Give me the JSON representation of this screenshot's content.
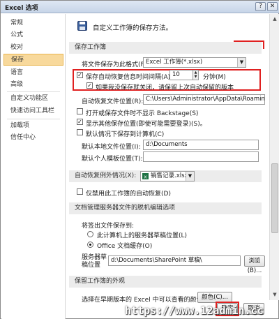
{
  "window": {
    "title": "Excel 选项",
    "help_btn": "?",
    "close_btn": "✕"
  },
  "sidebar": {
    "items": [
      {
        "label": "常规"
      },
      {
        "label": "公式"
      },
      {
        "label": "校对"
      },
      {
        "label": "保存",
        "selected": true
      },
      {
        "label": "语言"
      },
      {
        "label": "高级"
      },
      {
        "label": "自定义功能区"
      },
      {
        "label": "快速访问工具栏"
      },
      {
        "label": "加载项"
      },
      {
        "label": "信任中心"
      }
    ]
  },
  "main": {
    "heading": "自定义工作簿的保存方法。",
    "save_section": {
      "title": "保存工作簿",
      "format_label": "将文件保存为此格式(F):",
      "format_value": "Excel 工作簿(*.xlsx)",
      "autorecover_label": "保存自动恢复信息时间间隔(A)",
      "autorecover_checked": true,
      "autorecover_minutes": "10",
      "minutes_label": "分钟(M)",
      "keep_last_label": "如果我没保存就关闭，请保留上次自动保留的版本",
      "keep_last_checked": true,
      "recover_location_label": "自动恢复文件位置(R):",
      "recover_location_value": "C:\\Users\\Administrator\\AppData\\Roaming\\Mi",
      "no_backstage_label": "打开或保存文件时不显示 Backstage(S)",
      "no_backstage_checked": false,
      "show_more_label": "显示其他保存位置(即使可能需要登录)(S)。",
      "show_more_checked": true,
      "default_computer_label": "默认情况下保存到计算机(C)",
      "default_computer_checked": false,
      "local_location_label": "默认本地文件位置(I):",
      "local_location_value": "d:\\Documents",
      "template_location_label": "默认个人模板位置(T):",
      "template_location_value": ""
    },
    "exceptions_section": {
      "label": "自动恢复例外情况(X):",
      "workbook": "销售记录.xlsx",
      "disable_label": "仅禁用此工作簿的自动恢复(D)",
      "disable_checked": false
    },
    "offline_section": {
      "title": "文档管理服务器文件的脱机编辑选项",
      "save_to_label": "将签出文件保存到:",
      "opt_server": "此计算机上的服务器草稿位置(L)",
      "opt_cache": "Office 文档缓存(O)",
      "drafts_label_1": "服务器草",
      "drafts_label_2": "稿位置",
      "drafts_value": "d:\\Documents\\SharePoint 草稿\\",
      "browse_label": "浏览(B)..."
    },
    "appearance_section": {
      "title": "保留工作簿的外观",
      "colors_label": "选择在早期版本的 Excel 中可以查看的颜色:",
      "colors_button": "颜色(C)..."
    }
  },
  "footer": {
    "ok_label": "确定",
    "cancel_label": "取消"
  },
  "watermark": "https://www.12admin.cc",
  "colors": {
    "highlight": "#e02020",
    "selected_nav": "#f8d99c",
    "section_bg": "#ececec"
  },
  "icons": [
    "save-disk-icon",
    "excel-file-icon",
    "dropdown-arrow-icon"
  ]
}
